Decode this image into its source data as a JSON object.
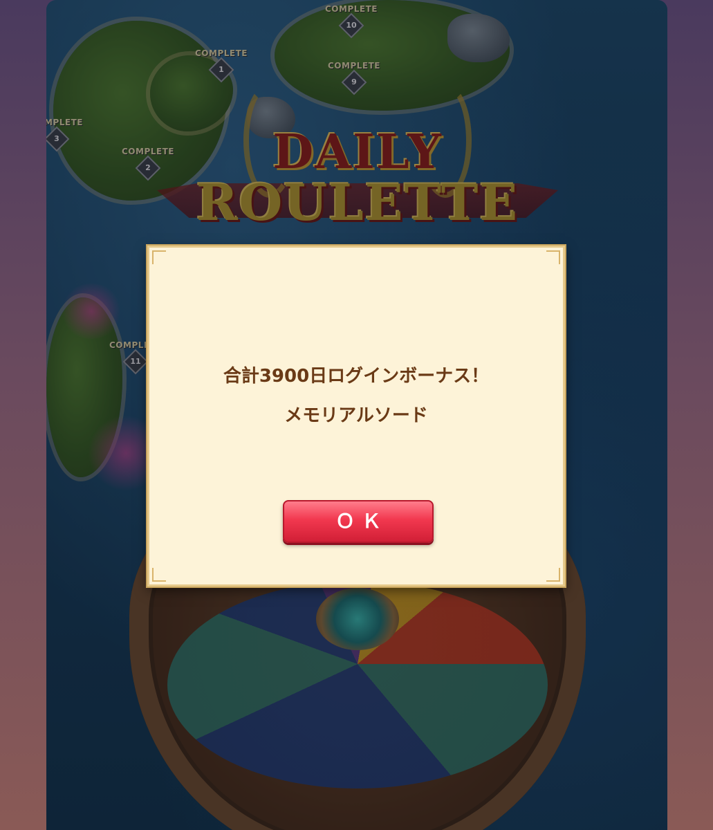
{
  "map": {
    "complete_label": "COMPLETE",
    "stages": [
      "1",
      "2",
      "3",
      "9",
      "10",
      "11"
    ]
  },
  "logo": {
    "line1": "DAILY",
    "line2": "ROULETTE"
  },
  "dialog": {
    "message_line1": "合計3900日ログインボーナス！",
    "message_line2": "メモリアルソード",
    "ok_label": "ＯＫ"
  }
}
